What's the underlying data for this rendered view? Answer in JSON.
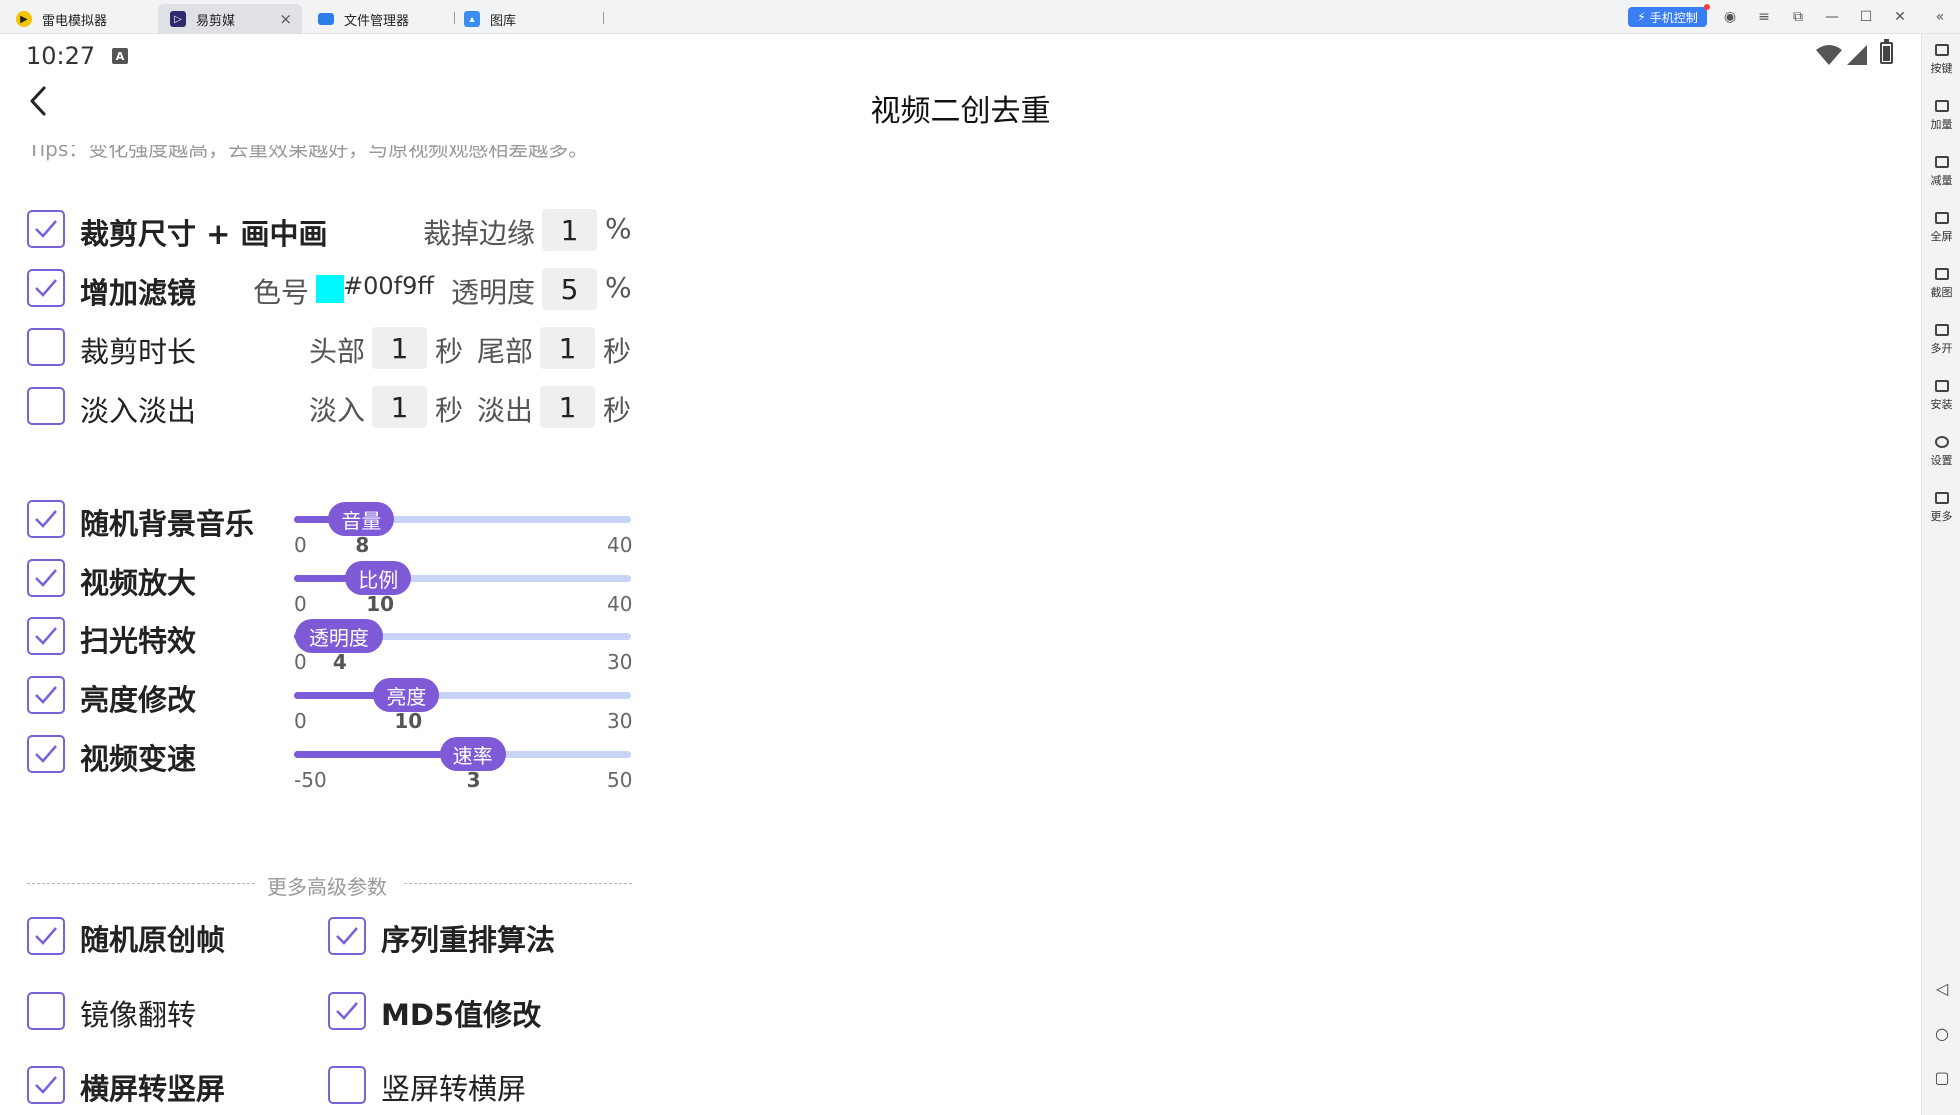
{
  "emulator": {
    "tabs": [
      {
        "label": "雷电模拟器",
        "icon": "leidian-logo-icon"
      },
      {
        "label": "易剪媒",
        "icon": "app-logo-icon"
      },
      {
        "label": "文件管理器",
        "icon": "folder-icon"
      },
      {
        "label": "图库",
        "icon": "gallery-icon"
      }
    ],
    "phone_control_label": "手机控制",
    "sidebar": [
      {
        "label": "按键",
        "icon": "keyboard-icon"
      },
      {
        "label": "加量",
        "icon": "volume-up-icon"
      },
      {
        "label": "减量",
        "icon": "volume-down-icon"
      },
      {
        "label": "全屏",
        "icon": "fullscreen-icon"
      },
      {
        "label": "截图",
        "icon": "scissors-icon"
      },
      {
        "label": "多开",
        "icon": "multi-instance-icon"
      },
      {
        "label": "安装",
        "icon": "install-icon"
      },
      {
        "label": "设置",
        "icon": "settings-icon"
      },
      {
        "label": "更多",
        "icon": "more-icon"
      }
    ]
  },
  "status": {
    "time": "10:27",
    "notif_letter": "A"
  },
  "page": {
    "title": "视频二创去重",
    "tips": "Tips：变化强度越高，去重效果越好，与原视频观感相差越多。"
  },
  "options": {
    "crop": {
      "label": "裁剪尺寸 + 画中画",
      "checked": true,
      "edge_label": "裁掉边缘",
      "edge_value": "1",
      "unit": "%"
    },
    "filter": {
      "label": "增加滤镜",
      "checked": true,
      "color_label": "色号",
      "color_value": "#00f9ff",
      "opacity_label": "透明度",
      "opacity_value": "5",
      "unit": "%"
    },
    "trim": {
      "label": "裁剪时长",
      "checked": false,
      "head_label": "头部",
      "head_value": "1",
      "tail_label": "尾部",
      "tail_value": "1",
      "unit": "秒"
    },
    "fade": {
      "label": "淡入淡出",
      "checked": false,
      "in_label": "淡入",
      "in_value": "1",
      "out_label": "淡出",
      "out_value": "1",
      "unit": "秒"
    }
  },
  "sliders": [
    {
      "label": "随机背景音乐",
      "checked": true,
      "thumb": "音量",
      "min": "0",
      "max": "40",
      "value": "8",
      "min_num": 0,
      "max_num": 40,
      "num": 8
    },
    {
      "label": "视频放大",
      "checked": true,
      "thumb": "比例",
      "min": "0",
      "max": "40",
      "value": "10",
      "min_num": 0,
      "max_num": 40,
      "num": 10
    },
    {
      "label": "扫光特效",
      "checked": true,
      "thumb": "透明度",
      "min": "0",
      "max": "30",
      "value": "4",
      "min_num": 0,
      "max_num": 30,
      "num": 4
    },
    {
      "label": "亮度修改",
      "checked": true,
      "thumb": "亮度",
      "min": "0",
      "max": "30",
      "value": "10",
      "min_num": 0,
      "max_num": 30,
      "num": 10
    },
    {
      "label": "视频变速",
      "checked": true,
      "thumb": "速率",
      "min": "-50",
      "max": "50",
      "value": "3",
      "min_num": -50,
      "max_num": 50,
      "num": 3
    }
  ],
  "advanced": {
    "divider_label": "更多高级参数",
    "items": [
      {
        "label": "随机原创帧",
        "checked": true
      },
      {
        "label": "序列重排算法",
        "checked": true
      },
      {
        "label": "镜像翻转",
        "checked": false
      },
      {
        "label": "MD5值修改",
        "checked": true
      },
      {
        "label": "横屏转竖屏",
        "checked": true
      },
      {
        "label": "竖屏转横屏",
        "checked": false
      }
    ]
  },
  "colors": {
    "accent": "#7b5bd7",
    "track": "#c9d2f7",
    "swatch": "#00f9ff"
  }
}
